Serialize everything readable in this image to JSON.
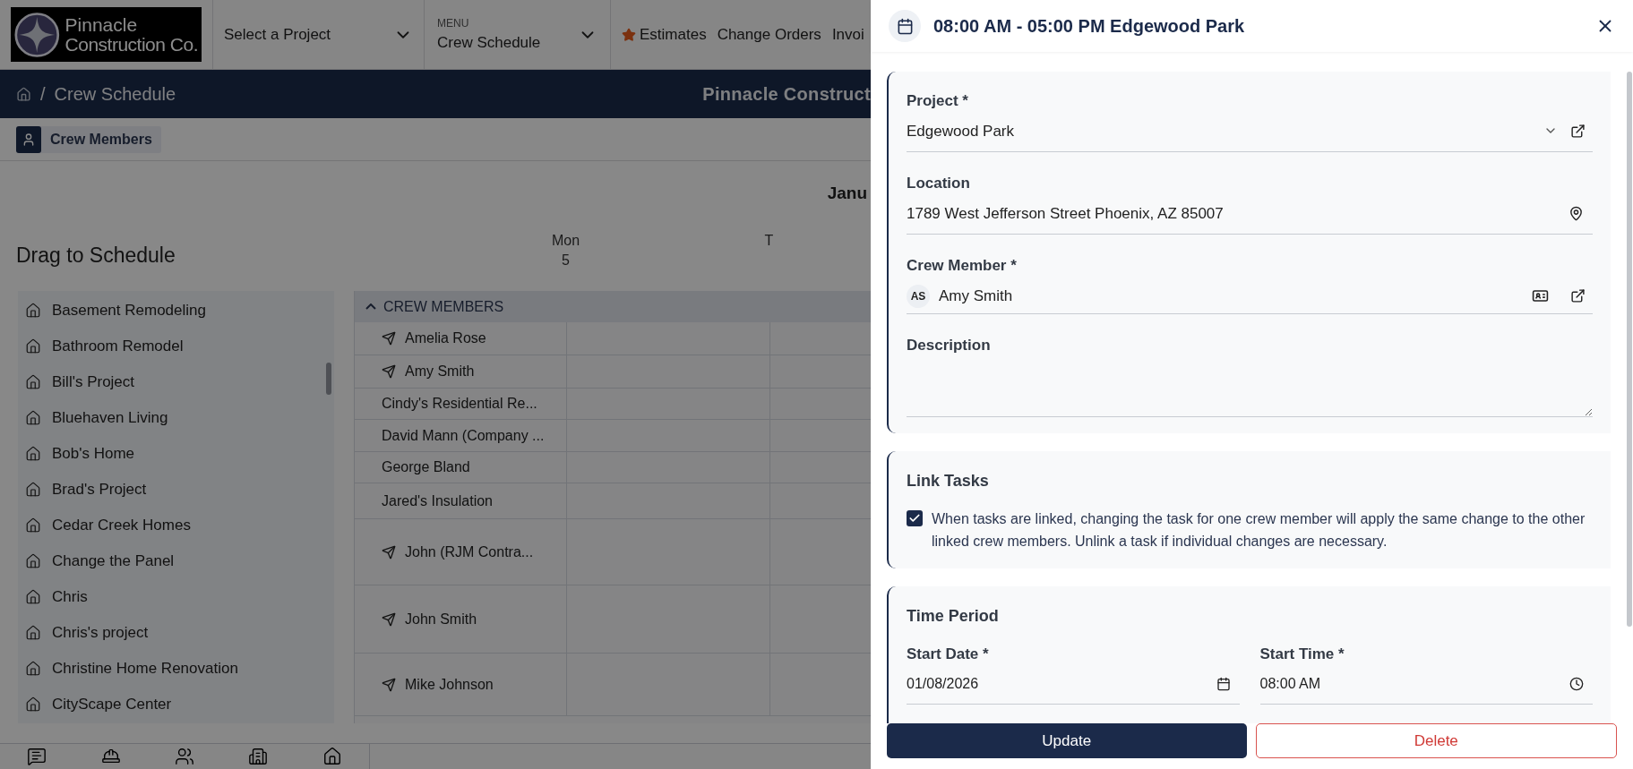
{
  "header": {
    "logo": {
      "line_1": "Pinnacle",
      "line_2": "Construction Co."
    },
    "project_select": {
      "value": "Select a Project"
    },
    "menu": {
      "label": "MENU",
      "value": "Crew Schedule"
    },
    "nav_links": [
      {
        "label": "Estimates",
        "starred": true
      },
      {
        "label": "Change Orders",
        "starred": false
      },
      {
        "label": "Invoi",
        "starred": false
      }
    ]
  },
  "breadcrumb": {
    "separator": "/",
    "current": "Crew Schedule",
    "company_title": "Pinnacle Construct"
  },
  "toolbar": {
    "crew_members_button": "Crew Members"
  },
  "calendar": {
    "month": "Janu",
    "days": [
      {
        "name": "Mon",
        "number": "5"
      },
      {
        "name": "T"
      }
    ]
  },
  "drag_panel": {
    "title": "Drag to Schedule",
    "projects": [
      "Basement Remodeling",
      "Bathroom Remodel",
      "Bill's Project",
      "Bluehaven Living",
      "Bob's Home",
      "Brad's Project",
      "Cedar Creek Homes",
      "Change the Panel",
      "Chris",
      "Chris's project",
      "Christine Home Renovation",
      "CityScape Center"
    ]
  },
  "crew_group": {
    "label": "CREW MEMBERS",
    "expanded": true,
    "rows": [
      {
        "name": "Amelia Rose",
        "send_icon": true
      },
      {
        "name": "Amy Smith",
        "send_icon": true
      },
      {
        "name": "Cindy's Residential Re...",
        "send_icon": false
      },
      {
        "name": "David Mann (Company ...",
        "send_icon": false
      },
      {
        "name": "George Bland",
        "send_icon": false
      },
      {
        "name": "Jared's Insulation",
        "send_icon": false
      },
      {
        "name": "John (RJM Contra...",
        "send_icon": true
      },
      {
        "name": "John Smith",
        "send_icon": true
      },
      {
        "name": "Mike Johnson",
        "send_icon": true
      }
    ]
  },
  "dialog": {
    "title": "08:00 AM - 05:00 PM Edgewood Park",
    "project": {
      "label": "Project *",
      "value": "Edgewood Park"
    },
    "location": {
      "label": "Location",
      "value": "1789 West Jefferson Street Phoenix, AZ 85007"
    },
    "crew_member": {
      "label": "Crew Member *",
      "initials": "AS",
      "value": "Amy Smith"
    },
    "description": {
      "label": "Description"
    },
    "link_tasks": {
      "heading": "Link Tasks",
      "checked": true,
      "text": "When tasks are linked, changing the task for one crew member will apply the same change to the other linked crew members. Unlink a task if individual changes are necessary."
    },
    "time_period": {
      "heading": "Time Period",
      "start_date": {
        "label": "Start Date *",
        "value": "01/08/2026"
      },
      "start_time": {
        "label": "Start Time *",
        "value": "08:00 AM"
      }
    },
    "buttons": {
      "update": "Update",
      "delete": "Delete"
    }
  }
}
